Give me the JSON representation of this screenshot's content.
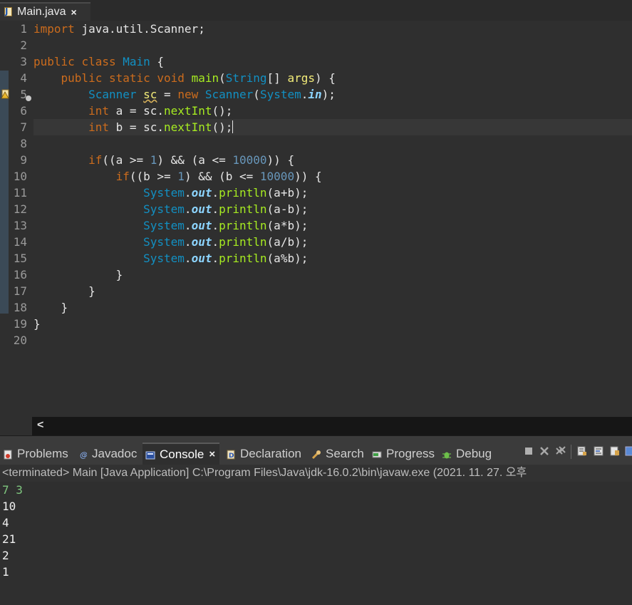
{
  "editor_tab": {
    "title": "Main.java",
    "close": "×"
  },
  "line_numbers": [
    "1",
    "2",
    "3",
    "4",
    "5",
    "6",
    "7",
    "8",
    "9",
    "10",
    "11",
    "12",
    "13",
    "14",
    "15",
    "16",
    "17",
    "18",
    "19",
    "20"
  ],
  "code": {
    "l1": {
      "kw": "import",
      "rest": " java.util.Scanner;"
    },
    "l3": {
      "kw1": "public",
      "kw2": "class",
      "type": "Main",
      "rest": " {"
    },
    "l4": {
      "kw1": "public",
      "kw2": "static",
      "kw3": "void",
      "method": "main",
      "p1": "(",
      "type": "String",
      "p2": "[] ",
      "arg": "args",
      "rest": ") {"
    },
    "l5": {
      "type1": "Scanner",
      "var": "sc",
      "eq": " = ",
      "kw": "new",
      "type2": "Scanner",
      "p1": "(",
      "type3": "System",
      "dot": ".",
      "field": "in",
      "rest": ");"
    },
    "l6": {
      "kw": "int",
      "a": " a = sc.",
      "method": "nextInt",
      "rest": "();"
    },
    "l7": {
      "kw": "int",
      "a": " b = sc.",
      "method": "nextInt",
      "rest": "();"
    },
    "l9": {
      "kw": "if",
      "a": "((a >= ",
      "n1": "1",
      "b": ") && (a <= ",
      "n2": "10000",
      "rest": ")) {"
    },
    "l10": {
      "kw": "if",
      "a": "((b >= ",
      "n1": "1",
      "b": ") && (b <= ",
      "n2": "10000",
      "rest": ")) {"
    },
    "prints": [
      {
        "sys": "System",
        "dot": ".",
        "out": "out",
        "dot2": ".",
        "println": "println",
        "arg": "(a+b);"
      },
      {
        "sys": "System",
        "dot": ".",
        "out": "out",
        "dot2": ".",
        "println": "println",
        "arg": "(a-b);"
      },
      {
        "sys": "System",
        "dot": ".",
        "out": "out",
        "dot2": ".",
        "println": "println",
        "arg": "(a*b);"
      },
      {
        "sys": "System",
        "dot": ".",
        "out": "out",
        "dot2": ".",
        "println": "println",
        "arg": "(a/b);"
      },
      {
        "sys": "System",
        "dot": ".",
        "out": "out",
        "dot2": ".",
        "println": "println",
        "arg": "(a%b);"
      }
    ],
    "brace": "}"
  },
  "hscroll": {
    "left_arrow": "<"
  },
  "views": {
    "tabs": [
      {
        "label": "Problems",
        "icon": "problems-icon"
      },
      {
        "label": "Javadoc",
        "icon": "javadoc-icon"
      },
      {
        "label": "Console",
        "icon": "console-icon",
        "close": "×"
      },
      {
        "label": "Declaration",
        "icon": "declaration-icon"
      },
      {
        "label": "Search",
        "icon": "search-icon"
      },
      {
        "label": "Progress",
        "icon": "progress-icon"
      },
      {
        "label": "Debug",
        "icon": "debug-icon"
      }
    ]
  },
  "console": {
    "header": "<terminated> Main [Java Application] C:\\Program Files\\Java\\jdk-16.0.2\\bin\\javaw.exe  (2021. 11. 27. 오후",
    "input": "7 3",
    "outputs": [
      "10",
      "4",
      "21",
      "2",
      "1"
    ]
  },
  "colors": {
    "background": "#2f2f2f",
    "keyword": "#cc6c1d",
    "type": "#1290c3",
    "method": "#a7ec21",
    "number": "#6897bb",
    "field": "#8dd5ff",
    "variable": "#f3ec79"
  }
}
